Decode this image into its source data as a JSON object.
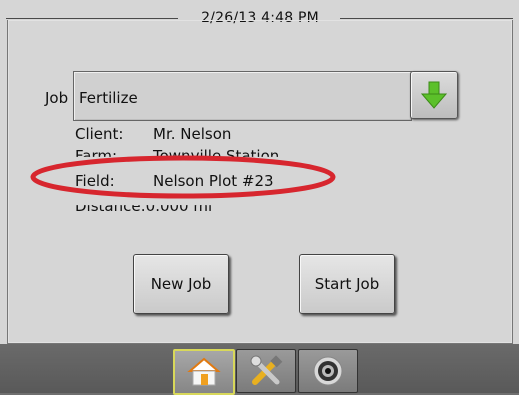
{
  "header": {
    "datetime": "2/26/13 4:48 PM"
  },
  "job": {
    "label": "Job",
    "value": "Fertilize",
    "dropdown_icon": "green-down-arrow-icon"
  },
  "info": {
    "client_label": "Client:",
    "client_value": "Mr. Nelson",
    "farm_label": "Farm:",
    "farm_value": "Townville Station",
    "field_label": "Field:",
    "field_value": "Nelson Plot #23",
    "distance_label": "Distance:",
    "distance_value": "0.000 mi"
  },
  "buttons": {
    "new_job": "New Job",
    "start_job": "Start Job"
  },
  "nav": [
    {
      "name": "home",
      "icon": "home-icon",
      "active": true
    },
    {
      "name": "tools",
      "icon": "tools-icon",
      "active": false
    },
    {
      "name": "gauge",
      "icon": "gauge-icon",
      "active": false
    }
  ],
  "colors": {
    "highlight": "#d7262e",
    "arrow": "#5cc02a",
    "active_tab": "#d8d85a"
  }
}
